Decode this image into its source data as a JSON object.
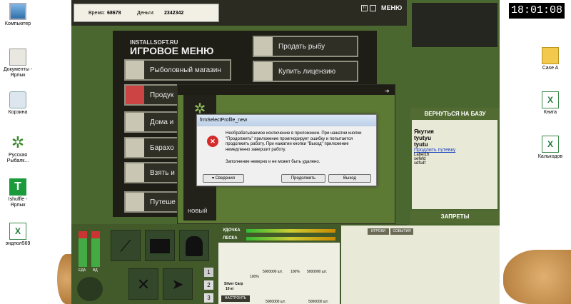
{
  "desktop_left": [
    {
      "label": "Компьютер"
    },
    {
      "label": "Документы - Ярлык"
    },
    {
      "label": "Корзина"
    },
    {
      "label": "Русская Рыбалк..."
    },
    {
      "label": "Ishuffle - Ярлык"
    },
    {
      "label": "эндпол569"
    }
  ],
  "desktop_right": [
    {
      "label": "Case A"
    },
    {
      "label": "Книга"
    },
    {
      "label": "Калькодов"
    }
  ],
  "clock": "18:01:08",
  "game": {
    "stats": {
      "time_label": "Время:",
      "time_value": "68678",
      "money_label": "Деньги:",
      "money_value": "2342342"
    },
    "menu_button": "МЕНЮ",
    "logo_small": "INSTALLSOFT.RU",
    "logo_title": "ИГРОВОЕ МЕНЮ",
    "menu_items": [
      {
        "label": "Рыболовный магазин"
      },
      {
        "label": "Продук"
      },
      {
        "label": "Дома и"
      },
      {
        "label": "Барахо"
      },
      {
        "label": "Взять и"
      },
      {
        "label": "Путеше"
      }
    ],
    "menu_right": [
      {
        "label": "Продать рыбу"
      },
      {
        "label": "Купить лицензию"
      }
    ],
    "crack_label": "НОВЫЙ"
  },
  "dialog": {
    "title": "frmSelectProfile_new",
    "message": "Необрабатываемое исключение в приложении. При нажатии кнопки \"Продолжить\" приложение проигнорирует ошибку и попытается продолжить работу. При нажатии кнопки \"Выход\" приложение немедленно завершит работу.",
    "detail": "Заполнение неверно и не может быть удалено.",
    "details_button": "Сведения",
    "continue_button": "Продолжить",
    "exit_button": "Выход"
  },
  "bottom": {
    "meter_labels": [
      "ЕДА",
      "ВД"
    ],
    "bar_labels": [
      "УДОЧКА",
      "ЛЕСКА"
    ],
    "page_numbers": [
      "1",
      "2",
      "3"
    ],
    "fish_name": "Silver Carp",
    "fish_weight": "10 кг",
    "settings_button": "НАСТРОИТЬ",
    "percents": [
      "100%",
      "100%"
    ],
    "amounts": [
      "5000000 шт.",
      "5000000 шт.",
      "5000000 шт.",
      "5000000 шт."
    ]
  },
  "right_panel": {
    "return_button": "ВЕРНУТЬСЯ НА БАЗУ",
    "lines": [
      "Якутия",
      "tyutyu",
      "tyutu"
    ],
    "link": "Продлить путевку",
    "extra": [
      "Label16",
      "sefefd",
      "sdfsdf"
    ],
    "bans_button": "ЗАПРЕТЫ",
    "tabs": [
      "ИГРОКИ",
      "СОБЫТИЯ"
    ]
  }
}
